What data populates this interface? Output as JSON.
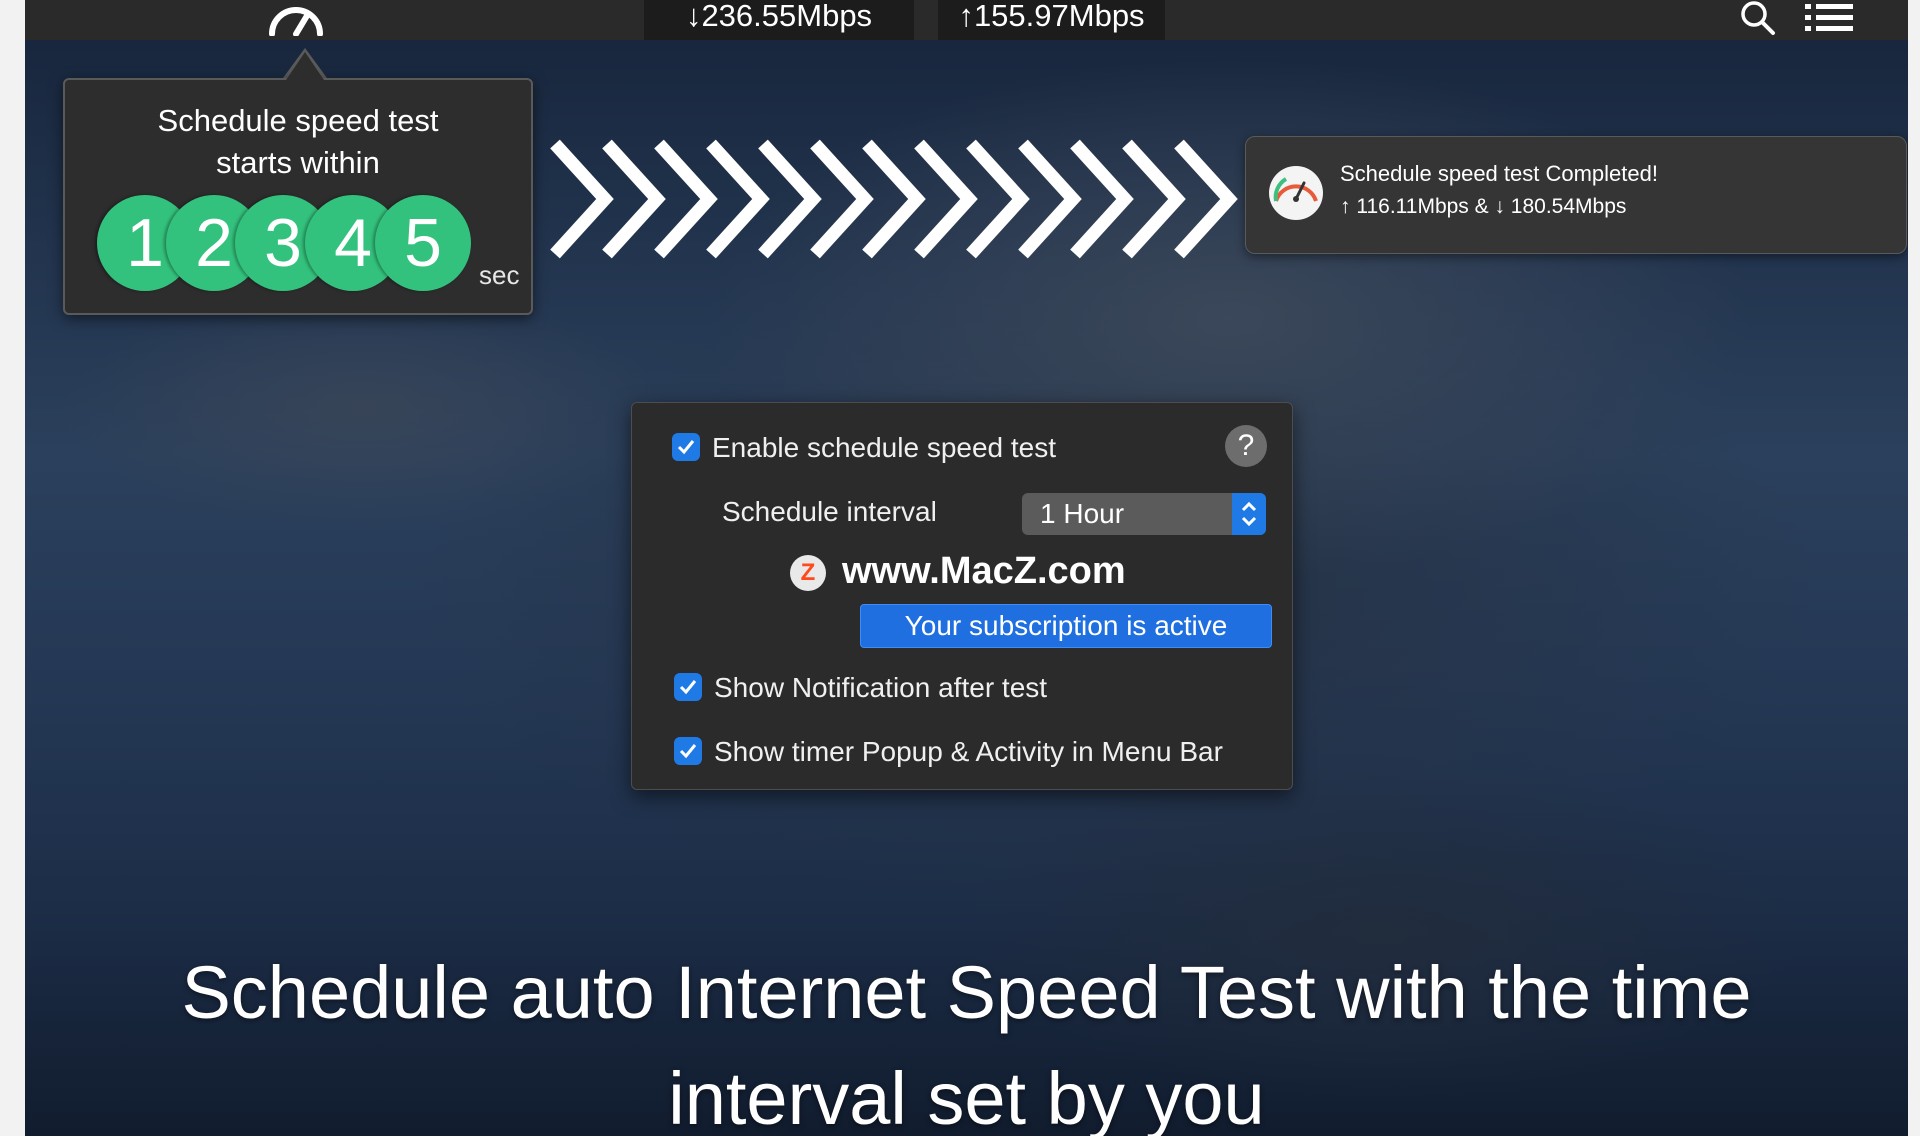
{
  "menubar": {
    "download_speed": "↓236.55Mbps",
    "upload_speed": "↑155.97Mbps",
    "icons": [
      "speedometer-icon",
      "search-icon",
      "list-icon"
    ]
  },
  "countdown_popup": {
    "title_line1": "Schedule speed test",
    "title_line2": "starts within",
    "digits": [
      "1",
      "2",
      "3",
      "4",
      "5"
    ],
    "unit": "sec",
    "digit_color": "#33c27d"
  },
  "notification": {
    "title": "Schedule speed test Completed!",
    "body": "↑ 116.11Mbps & ↓ 180.54Mbps",
    "icon": "speedometer-icon"
  },
  "settings_panel": {
    "enable_label": "Enable schedule speed test",
    "enable_checked": true,
    "help_label": "?",
    "interval_label": "Schedule interval",
    "interval_value": "1 Hour",
    "watermark": "www.MacZ.com",
    "watermark_logo": "Z",
    "subscription_label": "Your subscription is active",
    "notify_label": "Show Notification after test",
    "notify_checked": true,
    "timer_label": "Show timer Popup & Activity in Menu Bar",
    "timer_checked": true,
    "accent_color": "#1f7ae6"
  },
  "caption": {
    "line1": "Schedule auto Internet Speed Test with the time",
    "line2": "interval set by you"
  }
}
